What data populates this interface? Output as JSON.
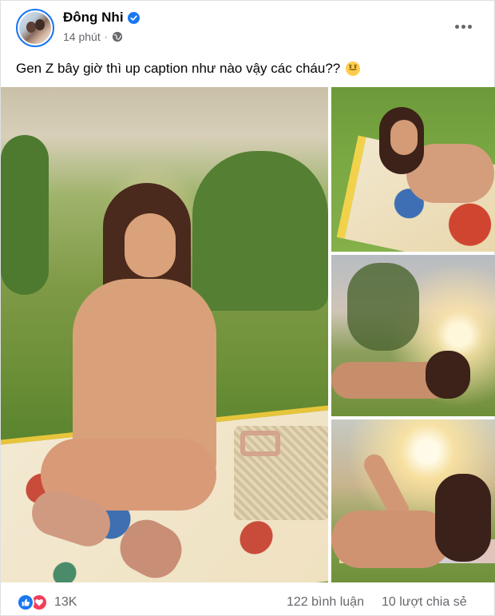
{
  "post": {
    "author": {
      "name": "Đông Nhi",
      "verified_icon": "verified-badge-icon"
    },
    "meta": {
      "time": "14 phút",
      "separator": "·",
      "privacy_icon": "globe-icon"
    },
    "caption": "Gen Z bây giờ thì up caption như nào vậy các cháu??",
    "caption_emoji": "smiling-face-icon",
    "more_icon": "more-options-icon",
    "photos": [
      {
        "name": "photo-kneeling-on-blanket"
      },
      {
        "name": "photo-lying-on-blanket"
      },
      {
        "name": "photo-reclining-sunset"
      },
      {
        "name": "photo-posing-sunburst"
      }
    ]
  },
  "footer": {
    "reactions": [
      "like-icon",
      "love-icon"
    ],
    "reaction_count": "13K",
    "comments": "122 bình luận",
    "shares": "10 lượt chia sẻ"
  },
  "colors": {
    "brand_blue": "#1877f2",
    "love_red": "#f33e58",
    "secondary_text": "#65676b"
  }
}
